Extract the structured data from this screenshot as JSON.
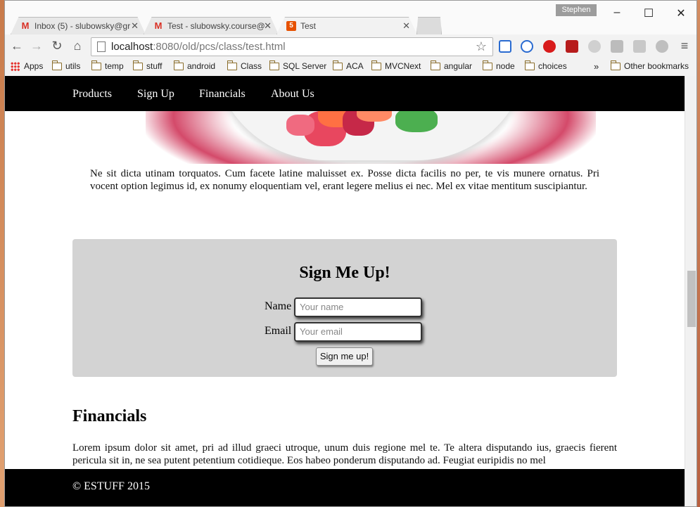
{
  "browser": {
    "tabs": [
      {
        "title": "Inbox (5) - slubowsky@gr",
        "icon": "gmail-icon"
      },
      {
        "title": "Test - slubowsky.course@",
        "icon": "gmail-icon"
      },
      {
        "title": "Test",
        "icon": "html5-icon"
      }
    ],
    "user": "Stephen",
    "url_host": "localhost",
    "url_path": ":8080/old/pcs/class/test.html",
    "bookmarks": [
      "Apps",
      "utils",
      "temp",
      "stuff",
      "android",
      "Class",
      "SQL Server",
      "ACA",
      "MVCNext",
      "angular",
      "node",
      "choices"
    ],
    "overflow": "»",
    "other_bookmarks": "Other bookmarks"
  },
  "page": {
    "nav": [
      "Products",
      "Sign Up",
      "Financials",
      "About Us"
    ],
    "intro_text": "Ne sit dicta utinam torquatos. Cum facete latine maluisset ex. Posse dicta facilis no per, te vis munere ornatus. Pri vocent option legimus id, ex nonumy eloquentiam vel, erant legere melius ei nec. Mel ex vitae mentitum suscipiantur.",
    "signup": {
      "heading": "Sign Me Up!",
      "name_label": "Name",
      "name_placeholder": "Your name",
      "email_label": "Email",
      "email_placeholder": "Your email",
      "button": "Sign me up!"
    },
    "financials_heading": "Financials",
    "financials_text": "Lorem ipsum dolor sit amet, pri ad illud graeci utroque, unum duis regione mel te. Te altera disputando ius, graecis fierent pericula sit in, ne sea putent petentium cotidieque. Eos habeo ponderum disputando ad. Feugiat euripidis no mel",
    "footer": "© ESTUFF 2015"
  }
}
